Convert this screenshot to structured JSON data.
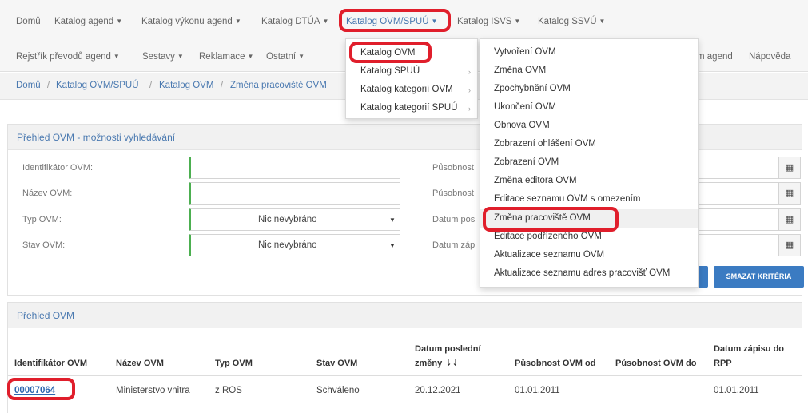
{
  "nav": {
    "row1": [
      {
        "label": "Domů",
        "caret": false
      },
      {
        "label": "Katalog agend",
        "caret": true
      },
      {
        "label": "Katalog výkonu agend",
        "caret": true
      },
      {
        "label": "Katalog DTÚA",
        "caret": true
      },
      {
        "label": "Katalog OVM/SPUÚ",
        "caret": true
      },
      {
        "label": "Katalog ISVS",
        "caret": true
      },
      {
        "label": "Katalog SSVÚ",
        "caret": true
      }
    ],
    "row2": [
      {
        "label": "Rejstřík převodů agend",
        "caret": true
      },
      {
        "label": "Sestavy",
        "caret": true
      },
      {
        "label": "Reklamace",
        "caret": true
      },
      {
        "label": "Ostatní",
        "caret": true
      }
    ],
    "row2_right": [
      "m agend",
      "Nápověda"
    ]
  },
  "breadcrumb": [
    "Domů",
    "Katalog OVM/SPUÚ",
    "Katalog OVM",
    "Změna pracoviště OVM"
  ],
  "search": {
    "title": "Přehled OVM - možnosti vyhledávání",
    "fields": [
      {
        "label": "Identifikátor OVM:",
        "value": ""
      },
      {
        "label": "Název OVM:",
        "value": ""
      },
      {
        "label": "Typ OVM:",
        "value": "Nic nevybráno"
      },
      {
        "label": "Stav OVM:",
        "value": "Nic nevybráno"
      }
    ],
    "right_labels": [
      "Působnost",
      "Působnost",
      "Datum pos",
      "Datum záp"
    ],
    "clear_button": "SMAZAT KRITÉRIA"
  },
  "submenu": {
    "items": [
      {
        "label": "Katalog OVM",
        "arrow": false
      },
      {
        "label": "Katalog SPUÚ",
        "arrow": true
      },
      {
        "label": "Katalog kategorií OVM",
        "arrow": true
      },
      {
        "label": "Katalog kategorií SPUÚ",
        "arrow": true
      }
    ]
  },
  "menu": {
    "items": [
      "Vytvoření OVM",
      "Změna OVM",
      "Zpochybnění OVM",
      "Ukončení OVM",
      "Obnova OVM",
      "Zobrazení ohlášení OVM",
      "Zobrazení OVM",
      "Změna editora OVM",
      "Editace seznamu OVM s omezením",
      "Změna pracoviště OVM",
      "Editace podřízeného OVM",
      "Aktualizace seznamu OVM",
      "Aktualizace seznamu adres pracovišť OVM"
    ]
  },
  "results": {
    "title": "Přehled OVM",
    "columns": [
      [
        "Identifikátor OVM"
      ],
      [
        "Název OVM"
      ],
      [
        "Typ OVM"
      ],
      [
        "Stav OVM"
      ],
      [
        "Datum poslední",
        "změny ⇂⇃"
      ],
      [
        "Působnost OVM od"
      ],
      [
        "Působnost OVM do"
      ],
      [
        "Datum zápisu do",
        "RPP"
      ]
    ],
    "rows": [
      [
        "00007064",
        "Ministerstvo vnitra",
        "z ROS",
        "Schváleno",
        "20.12.2021",
        "01.01.2011",
        "",
        "01.01.2011"
      ]
    ]
  },
  "colors": {
    "accent": "#3b7bc2",
    "highlight": "#e01e2b",
    "required": "#4caf50"
  }
}
